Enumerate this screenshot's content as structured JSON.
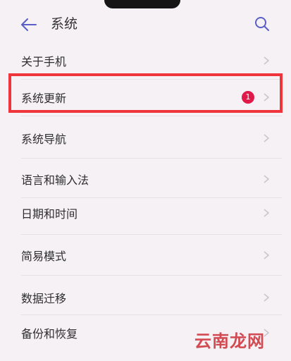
{
  "header": {
    "title": "系统",
    "back_icon": "back-arrow-icon",
    "search_icon": "search-icon"
  },
  "menu": {
    "items": [
      {
        "label": "关于手机"
      },
      {
        "label": "系统更新",
        "badge": "1",
        "highlighted": true
      },
      {
        "label": "系统导航"
      },
      {
        "label": "语言和输入法"
      },
      {
        "label": "日期和时间"
      },
      {
        "label": "简易模式"
      },
      {
        "label": "数据迁移"
      },
      {
        "label": "备份和恢复"
      }
    ]
  },
  "watermark": "云南龙网",
  "colors": {
    "accent": "#5a5fc8",
    "badge": "#e0194b",
    "highlight": "#f0343c",
    "background": "#f5f1f4"
  }
}
